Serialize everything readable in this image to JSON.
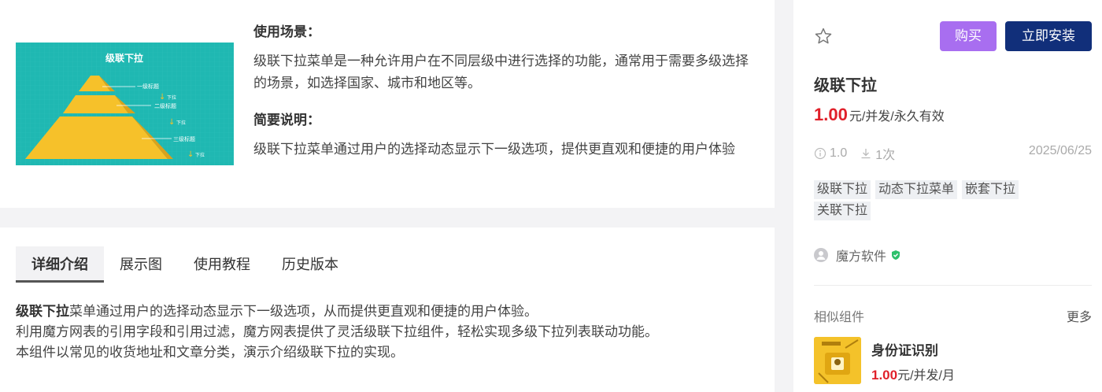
{
  "thumbnail": {
    "title": "级联下拉",
    "levels": [
      "一级标题",
      "二级标题",
      "三级标题"
    ],
    "arrow_label": "下拉",
    "bg_color": "#1fb8b2",
    "pyramid_color": "#f6c12a"
  },
  "usage": {
    "scene_title": "使用场景：",
    "scene_text": "级联下拉菜单是一种允许用户在不同层级中进行选择的功能，通常用于需要多级选择的场景，如选择国家、城市和地区等。",
    "brief_title": "简要说明：",
    "brief_text": "级联下拉菜单通过用户的选择动态显示下一级选项，提供更直观和便捷的用户体验"
  },
  "tabs": [
    "详细介绍",
    "展示图",
    "使用教程",
    "历史版本"
  ],
  "detail": {
    "lead_bold": "级联下拉",
    "lead_rest": "菜单通过用户的选择动态显示下一级选项，从而提供更直观和便捷的用户体验。",
    "line2": "利用魔方网表的引用字段和引用过滤，魔方网表提供了灵活级联下拉组件，轻松实现多级下拉列表联动功能。",
    "line3": "本组件以常见的收货地址和文章分类，演示介绍级联下拉的实现。"
  },
  "product": {
    "buy_label": "购买",
    "install_label": "立即安装",
    "name": "级联下拉",
    "price": "1.00",
    "price_unit": "元/并发/永久有效",
    "version": "1.0",
    "downloads": "1次",
    "date": "2025/06/25",
    "tags": [
      "级联下拉",
      "动态下拉菜单",
      "嵌套下拉",
      "关联下拉"
    ],
    "vendor": "魔方软件"
  },
  "similar": {
    "heading": "相似组件",
    "more": "更多",
    "item": {
      "name": "身份证识别",
      "price": "1.00",
      "price_unit": "元/并发/月"
    }
  },
  "colors": {
    "accent_buy": "#a86ef0",
    "accent_install": "#112f7a",
    "price_red": "#e0202a"
  }
}
